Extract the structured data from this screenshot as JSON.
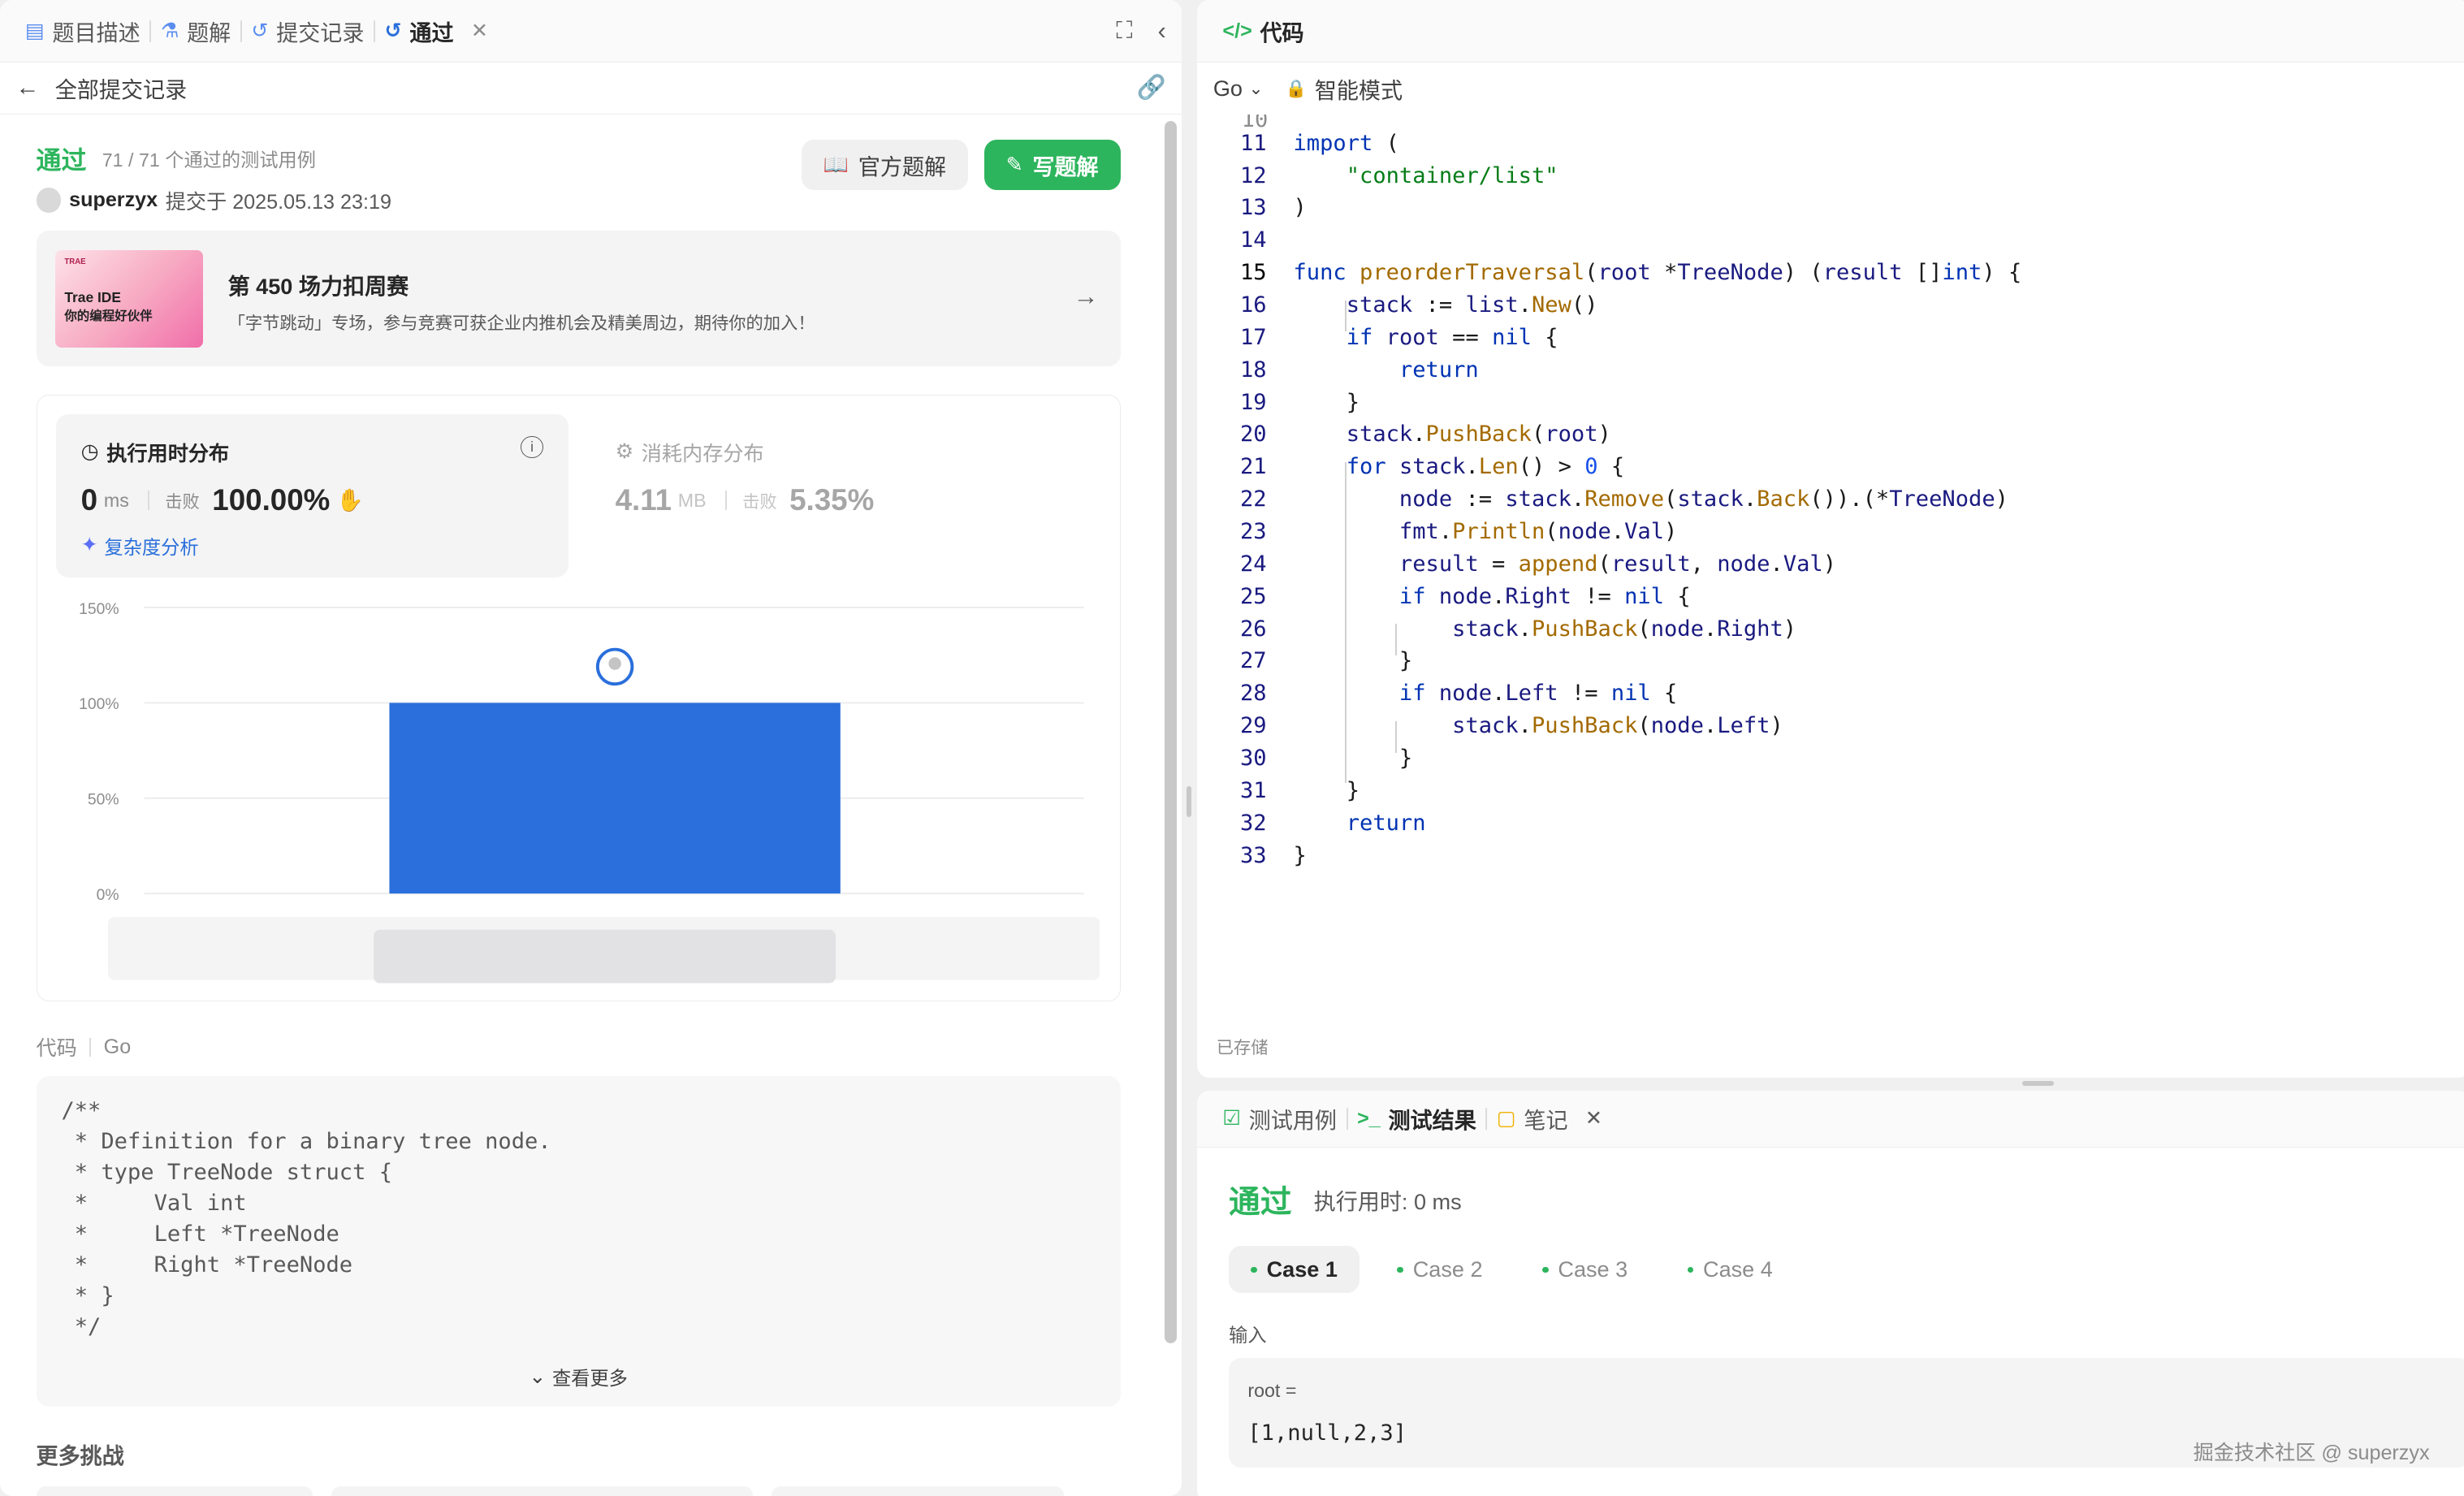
{
  "left_tabs": {
    "description": "题目描述",
    "solutions": "题解",
    "submissions": "提交记录",
    "accepted": "通过"
  },
  "submission_bar": {
    "back_label": "全部提交记录"
  },
  "result": {
    "status": "通过",
    "passed": "71 / 71 个通过的测试用例",
    "user": "superzyx",
    "submitted_at": "提交于 2025.05.13 23:19",
    "official_solution_label": "官方题解",
    "write_solution_label": "写题解"
  },
  "banner": {
    "thumb_line1": "Trae IDE",
    "thumb_line2": "你的编程好伙伴",
    "thumb_brand": "TRAE",
    "title": "第 450 场力扣周赛",
    "subtitle": "「字节跳动」专场，参与竞赛可获企业内推机会及精美周边，期待你的加入！"
  },
  "runtime": {
    "title": "执行用时分布",
    "value": "0",
    "unit": "ms",
    "beats_label": "击败",
    "beats": "100.00%",
    "complexity_label": "复杂度分析"
  },
  "memory": {
    "title": "消耗内存分布",
    "value": "4.11",
    "unit": "MB",
    "beats_label": "击败",
    "beats": "5.35%"
  },
  "chart_data": {
    "type": "bar",
    "categories": [
      ""
    ],
    "values": [
      100
    ],
    "yticks": [
      "150%",
      "100%",
      "50%",
      "0%"
    ],
    "ylim": [
      0,
      150
    ],
    "bar_color": "#2a6fdb"
  },
  "code_section": {
    "label": "代码",
    "lang": "Go",
    "lines": [
      "/**",
      " * Definition for a binary tree node.",
      " * type TreeNode struct {",
      " *     Val int",
      " *     Left *TreeNode",
      " *     Right *TreeNode",
      " * }",
      " */"
    ],
    "more_label": "查看更多"
  },
  "more_challenges": "更多挑战",
  "editor": {
    "title": "代码",
    "lang": "Go",
    "mode": "智能模式",
    "saved": "已存储",
    "line_numbers": [
      "11",
      "12",
      "13",
      "14",
      "15",
      "16",
      "17",
      "18",
      "19",
      "20",
      "21",
      "22",
      "23",
      "24",
      "25",
      "26",
      "27",
      "28",
      "29",
      "30",
      "31",
      "32",
      "33"
    ],
    "code": [
      "import (",
      "    \"container/list\"",
      ")",
      "",
      "func preorderTraversal(root *TreeNode) (result []int) {",
      "    stack := list.New()",
      "    if root == nil {",
      "        return",
      "    }",
      "    stack.PushBack(root)",
      "    for stack.Len() > 0 {",
      "        node := stack.Remove(stack.Back()).(*TreeNode)",
      "        fmt.Println(node.Val)",
      "        result = append(result, node.Val)",
      "        if node.Right != nil {",
      "            stack.PushBack(node.Right)",
      "        }",
      "        if node.Left != nil {",
      "            stack.PushBack(node.Left)",
      "        }",
      "    }",
      "    return",
      "}"
    ]
  },
  "bottom_tabs": {
    "testcase": "测试用例",
    "result": "测试结果",
    "notes": "笔记"
  },
  "test_result": {
    "status": "通过",
    "runtime": "执行用时: 0 ms",
    "cases": [
      "Case 1",
      "Case 2",
      "Case 3",
      "Case 4"
    ],
    "input_label": "输入",
    "var_name": "root =",
    "var_value": "[1,null,2,3]"
  },
  "watermark": "掘金技术社区 @ superzyx",
  "colors": {
    "accent_green": "#2db55d",
    "accent_blue": "#2a6fdb"
  }
}
